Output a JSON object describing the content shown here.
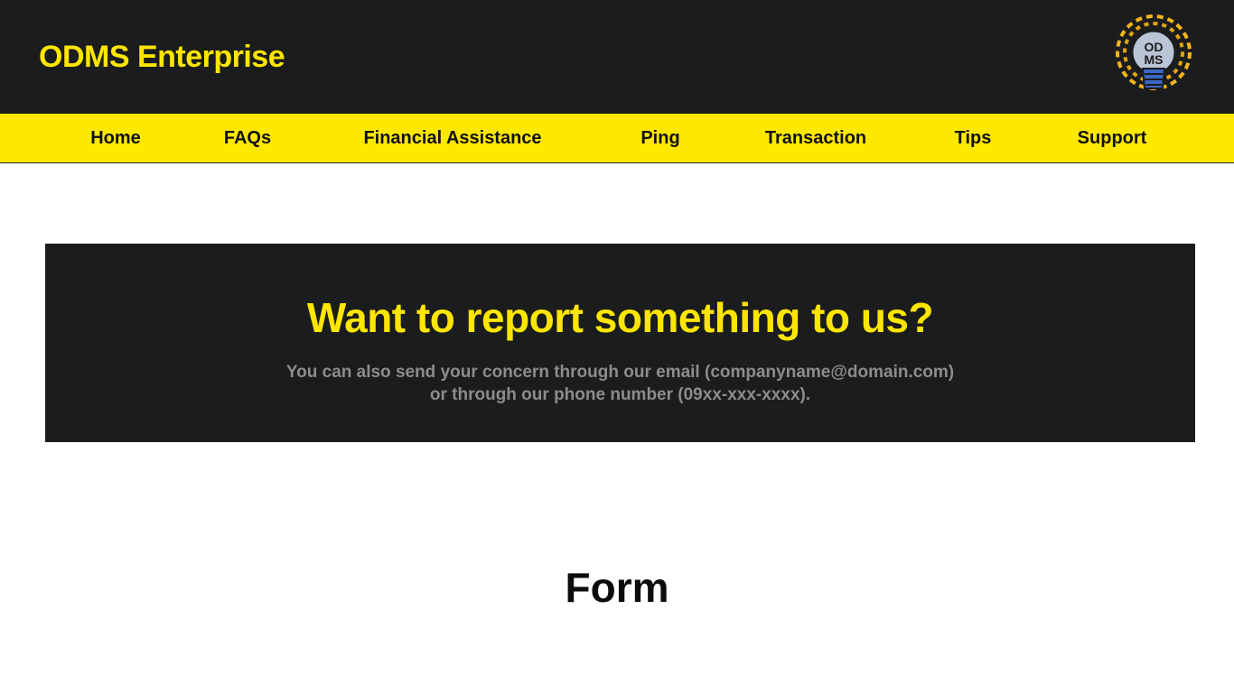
{
  "header": {
    "brand": "ODMS Enterprise",
    "logo_text_top": "OD",
    "logo_text_bottom": "MS",
    "logo_icon": "lightbulb-logo-icon"
  },
  "nav": {
    "items": [
      {
        "label": "Home"
      },
      {
        "label": "FAQs"
      },
      {
        "label": "Financial Assistance"
      },
      {
        "label": "Ping"
      },
      {
        "label": "Transaction"
      },
      {
        "label": "Tips"
      },
      {
        "label": "Support"
      }
    ]
  },
  "banner": {
    "title": "Want to report something to us?",
    "line1": "You can also send your concern through our email (companyname@domain.com)",
    "line2": "or through our phone number (09xx-xxx-xxxx)."
  },
  "form": {
    "heading": "Form"
  },
  "colors": {
    "dark": "#1b1c1e",
    "accent": "#ffe600",
    "muted_text": "#8c8c8c"
  }
}
